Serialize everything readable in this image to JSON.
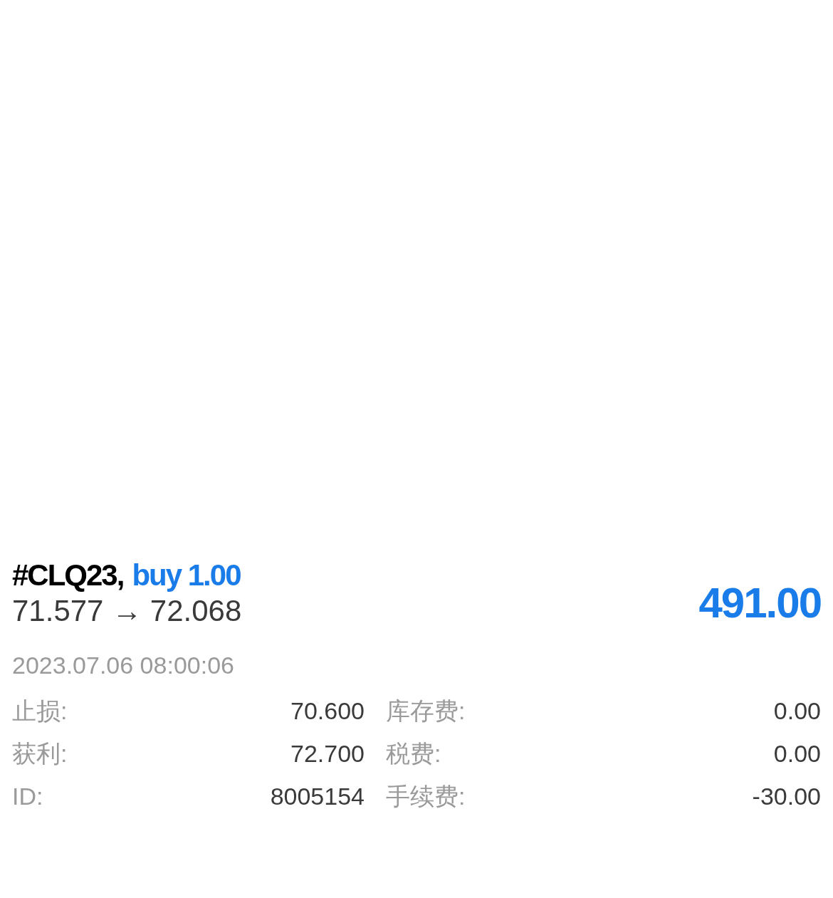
{
  "position": {
    "symbol": "#CLQ23,",
    "order": {
      "kind": "buy",
      "label": "buy 1.00"
    },
    "prices": "71.577 → 72.068",
    "profit": "491.00",
    "time": "2023.07.06 08:00:06",
    "details": [
      [
        {
          "label": "止损:",
          "value": "70.600"
        },
        {
          "label": "库存费:",
          "value": "0.00"
        }
      ],
      [
        {
          "label": "获利:",
          "value": "72.700"
        },
        {
          "label": "税费:",
          "value": "0.00"
        }
      ],
      [
        {
          "label": "ID:",
          "value": "8005154"
        },
        {
          "label": "手续费:",
          "value": "-30.00"
        }
      ]
    ]
  }
}
